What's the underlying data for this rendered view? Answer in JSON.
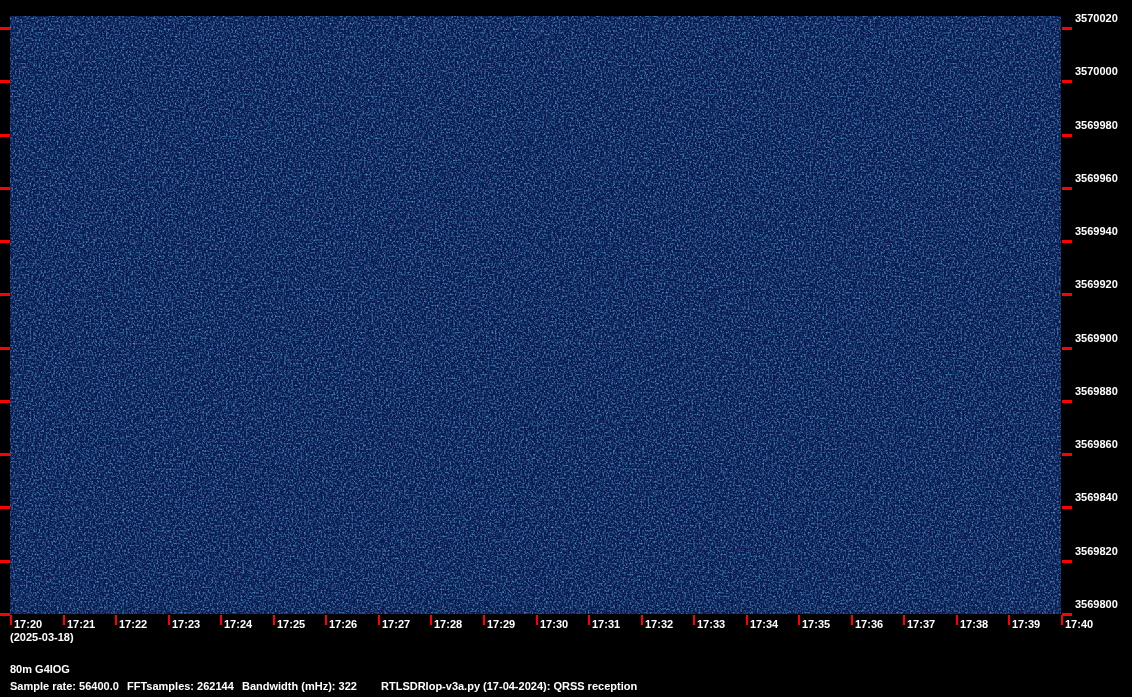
{
  "frequency_axis": {
    "labels": [
      "3570020",
      "3570000",
      "3569980",
      "3569960",
      "3569940",
      "3569920",
      "3569900",
      "3569880",
      "3569860",
      "3569840",
      "3569820",
      "3569800"
    ]
  },
  "time_axis": {
    "labels": [
      "17:20",
      "17:21",
      "17:22",
      "17:23",
      "17:24",
      "17:25",
      "17:26",
      "17:27",
      "17:28",
      "17:29",
      "17:30",
      "17:31",
      "17:32",
      "17:33",
      "17:34",
      "17:35",
      "17:36",
      "17:37",
      "17:38",
      "17:39",
      "17:40"
    ],
    "date": "(2025-03-18)"
  },
  "station": "80m G4IOG",
  "info": [
    "Sample rate: 56400.0",
    "FFTsamples: 262144",
    "Bandwidth (mHz): 322",
    "RTLSDRlop-v3a.py (17-04-2024): QRSS reception"
  ]
}
